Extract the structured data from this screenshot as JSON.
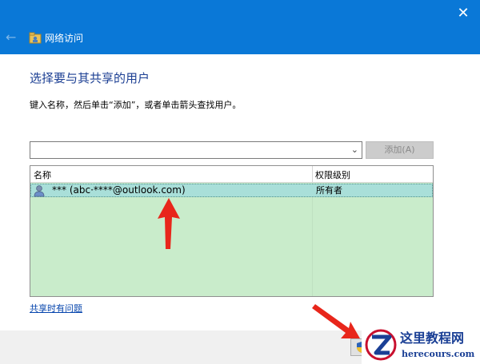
{
  "window": {
    "title": "网络访问",
    "close_glyph": "✕",
    "back_glyph": "←"
  },
  "main": {
    "heading": "选择要与其共享的用户",
    "instruction": "键入名称，然后单击“添加”，或者单击箭头查找用户。",
    "combo_value": "",
    "add_button": "添加(A)"
  },
  "grid": {
    "columns": [
      "名称",
      "权限级别"
    ],
    "rows": [
      {
        "user": "*** (abc·****@outlook.com)",
        "permission": "所有者",
        "selected": true
      }
    ]
  },
  "help_link": "共享时有问题",
  "watermark": {
    "title": "这里教程网",
    "url": "herecours.com"
  },
  "icons": {
    "app": "network-share-icon",
    "user": "user-icon",
    "shield": "uac-shield-icon",
    "chevron": "chevron-down-icon"
  },
  "colors": {
    "titlebar": "#0a78d7",
    "heading": "#1c3f93",
    "grid_bg": "#c9eccb",
    "selected_row": "#a9dfd9",
    "annotation_arrow": "#e8261b",
    "link": "#0645ad"
  }
}
